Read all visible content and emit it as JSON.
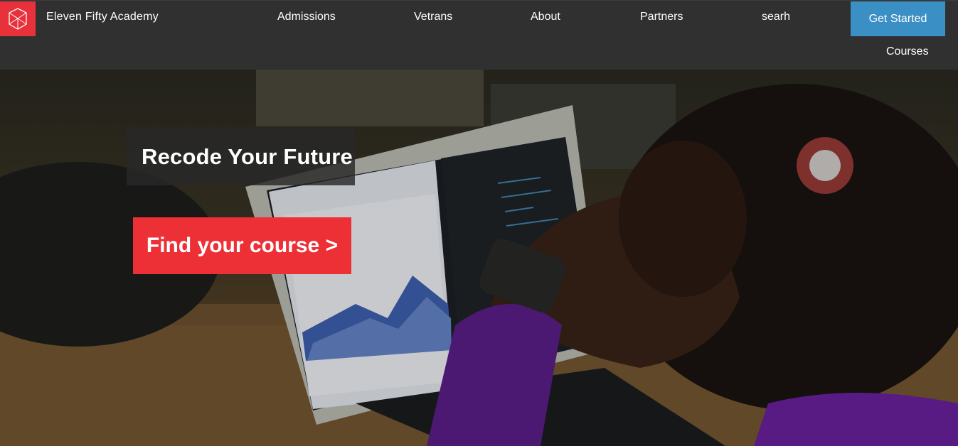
{
  "nav": {
    "brand": "Eleven Fifty Academy",
    "logo_icon": "geometric-shield-logo",
    "links": {
      "admissions": "Admissions",
      "vetrans": "Vetrans",
      "about": "About",
      "partners": "Partners",
      "search": "searh",
      "courses": "Courses"
    },
    "cta": "Get Started"
  },
  "hero": {
    "headline": "Recode Your Future",
    "button": "Find your course >"
  },
  "colors": {
    "nav_bg": "#303030",
    "logo_red": "#e8313a",
    "cta_blue": "#3a8fc4",
    "button_red": "#ed2f36"
  }
}
